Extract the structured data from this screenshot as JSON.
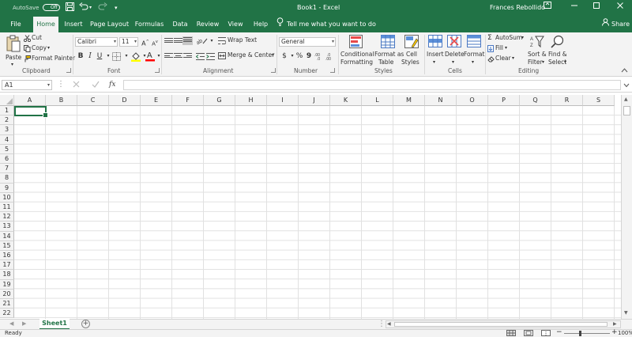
{
  "titlebar": {
    "autosave_label": "AutoSave",
    "autosave_state": "Off",
    "document_title": "Book1  -  Excel",
    "user_name": "Frances Rebollido",
    "bg_color": "#217346"
  },
  "tabs": [
    {
      "label": "File"
    },
    {
      "label": "Home",
      "active": true
    },
    {
      "label": "Insert"
    },
    {
      "label": "Page Layout"
    },
    {
      "label": "Formulas"
    },
    {
      "label": "Data"
    },
    {
      "label": "Review"
    },
    {
      "label": "View"
    },
    {
      "label": "Help"
    }
  ],
  "tell_me": "Tell me what you want to do",
  "share_label": "Share",
  "ribbon": {
    "clipboard": {
      "paste": "Paste",
      "cut": "Cut",
      "copy": "Copy",
      "format_painter": "Format Painter",
      "group": "Clipboard"
    },
    "font": {
      "font_name": "Calibri",
      "font_size": "11",
      "bold": "B",
      "italic": "I",
      "underline": "U",
      "group": "Font",
      "font_color": "#ff0000",
      "fill_color": "#ffff00"
    },
    "alignment": {
      "wrap_text": "Wrap Text",
      "merge_center": "Merge & Center",
      "group": "Alignment"
    },
    "number": {
      "format": "General",
      "currency": "$",
      "percent": "%",
      "comma": "9",
      "group": "Number"
    },
    "styles": {
      "conditional_1": "Conditional",
      "conditional_2": "Formatting",
      "format_table_1": "Format as",
      "format_table_2": "Table",
      "cell_styles_1": "Cell",
      "cell_styles_2": "Styles",
      "group": "Styles"
    },
    "cells": {
      "insert": "Insert",
      "delete": "Delete",
      "format": "Format",
      "group": "Cells"
    },
    "editing": {
      "autosum": "AutoSum",
      "fill": "Fill",
      "clear": "Clear",
      "sort_filter_1": "Sort &",
      "sort_filter_2": "Filter",
      "find_select_1": "Find &",
      "find_select_2": "Select",
      "group": "Editing"
    }
  },
  "formula_bar": {
    "name_box": "A1",
    "fx": "fx",
    "value": ""
  },
  "grid": {
    "columns": [
      "A",
      "B",
      "C",
      "D",
      "E",
      "F",
      "G",
      "H",
      "I",
      "J",
      "K",
      "L",
      "M",
      "N",
      "O",
      "P",
      "Q",
      "R",
      "S"
    ],
    "rows": [
      "1",
      "2",
      "3",
      "4",
      "5",
      "6",
      "7",
      "8",
      "9",
      "10",
      "11",
      "12",
      "13",
      "14",
      "15",
      "16",
      "17",
      "18",
      "19",
      "20",
      "21",
      "22"
    ],
    "selected_cell": "A1"
  },
  "sheets": [
    {
      "name": "Sheet1",
      "active": true
    }
  ],
  "status": {
    "ready": "Ready",
    "zoom": "100%"
  }
}
